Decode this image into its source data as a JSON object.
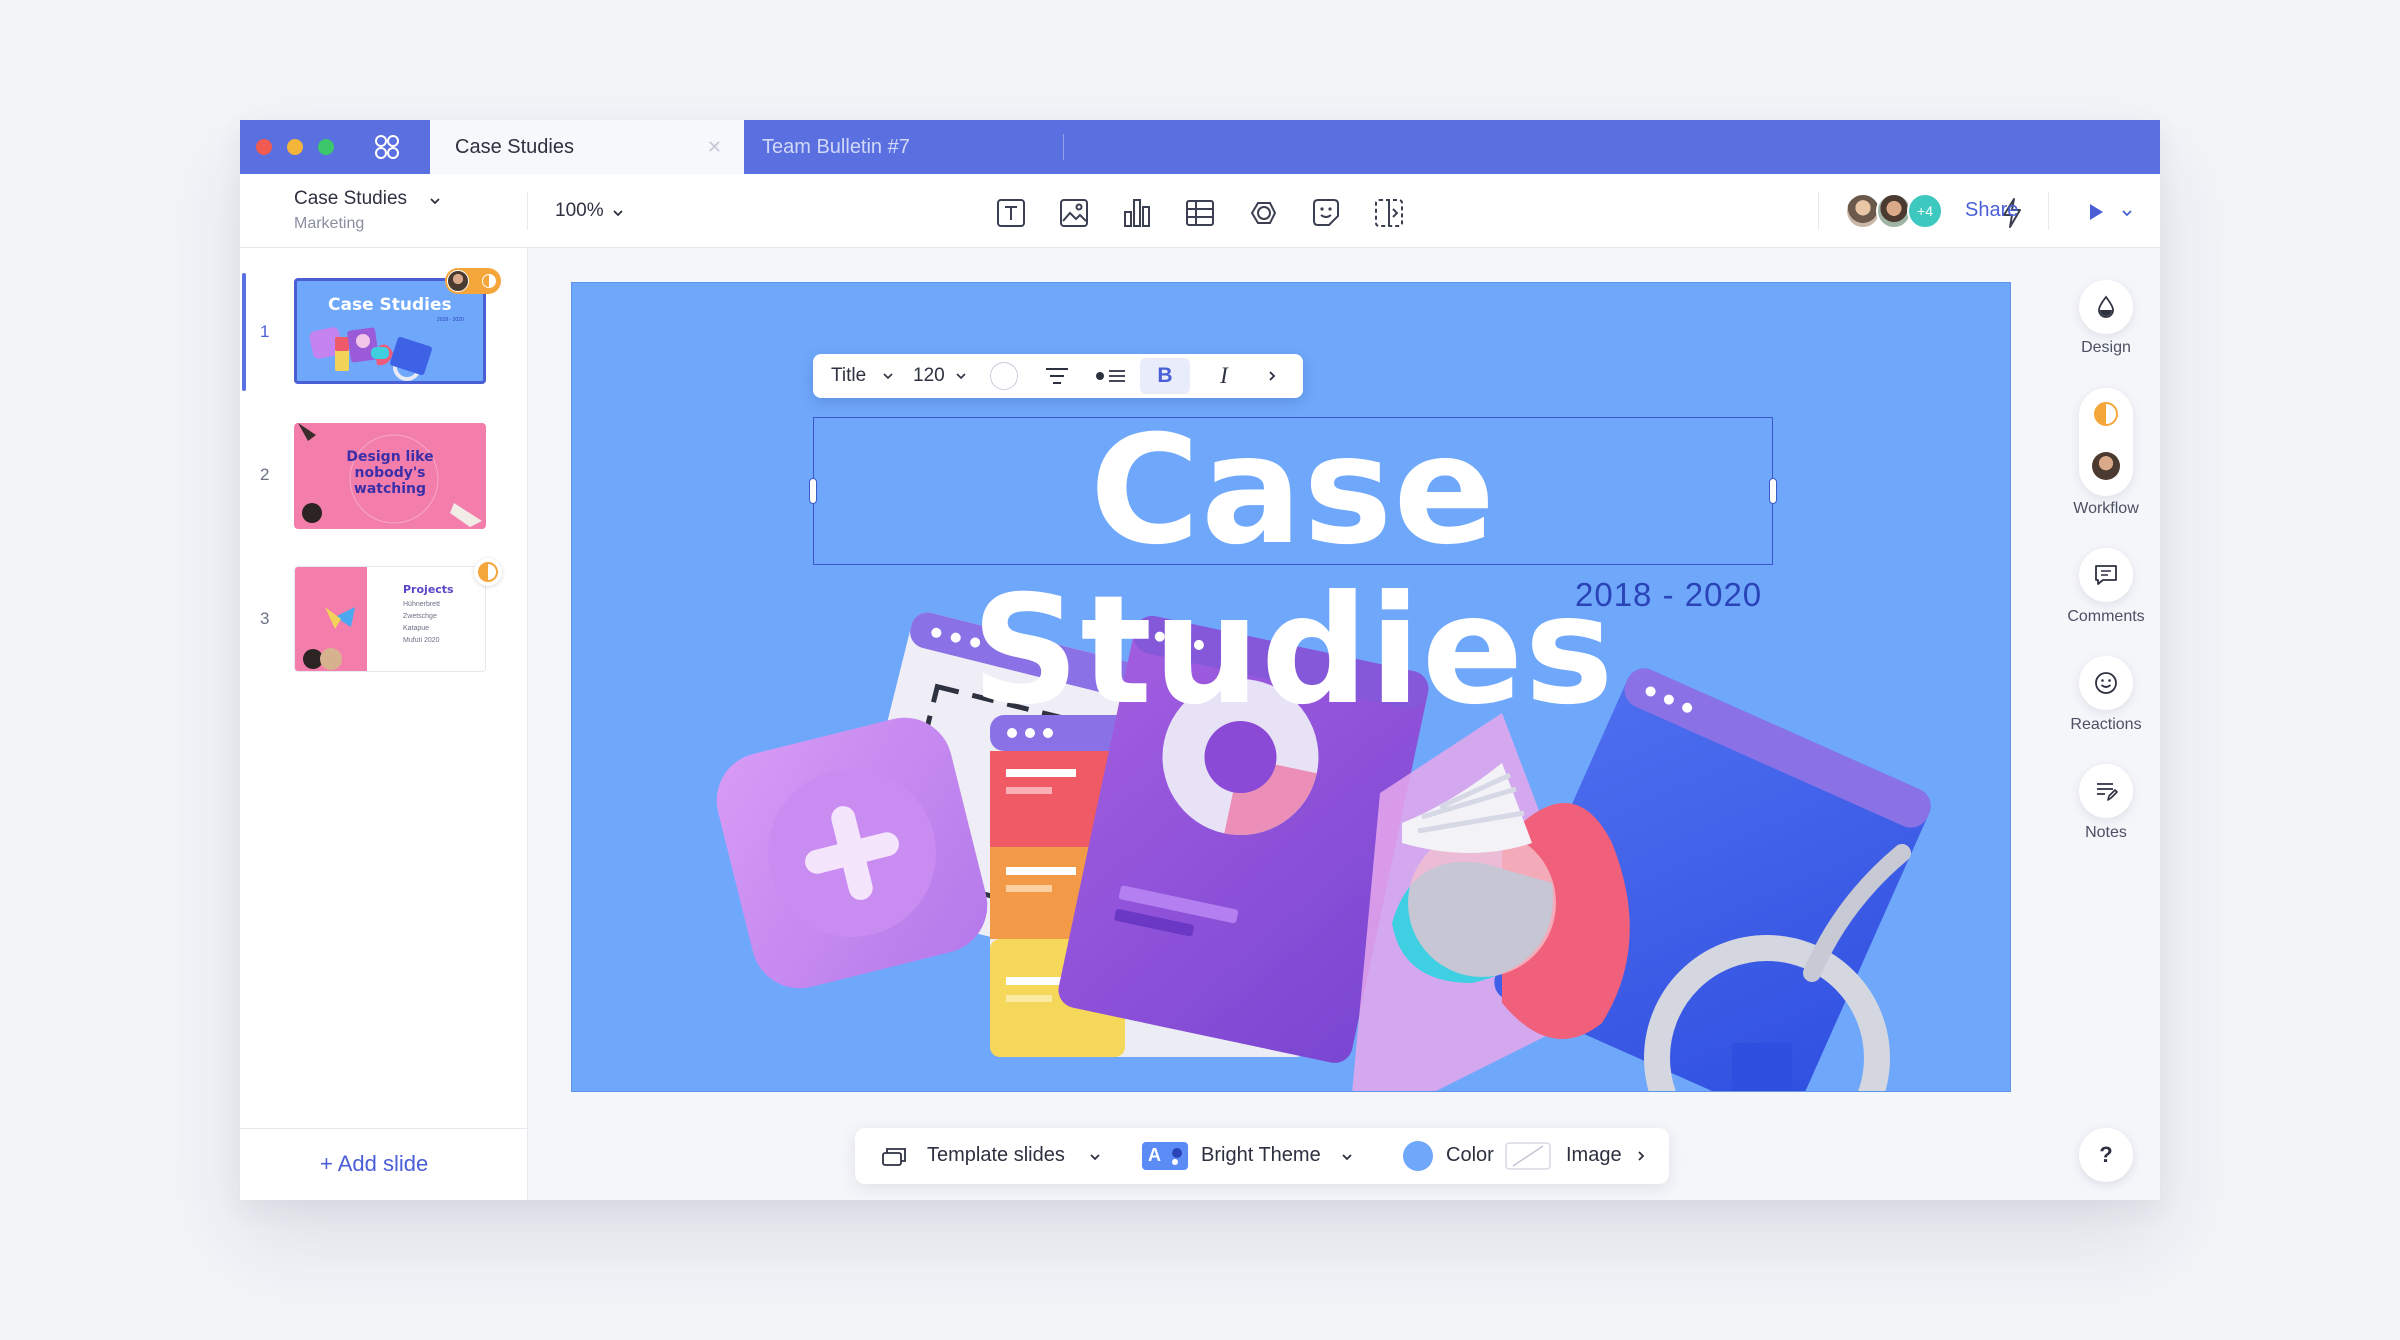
{
  "window": {
    "tabs": [
      {
        "label": "Case Studies",
        "active": true
      },
      {
        "label": "Team Bulletin #7",
        "active": false
      }
    ]
  },
  "toolbar": {
    "doc_title": "Case Studies",
    "doc_subtitle": "Marketing",
    "zoom": "100%",
    "insert_tools": [
      "text-icon",
      "image-icon",
      "chart-icon",
      "table-icon",
      "shape-icon",
      "sticker-icon",
      "embed-icon"
    ],
    "collaborators_extra": "+4",
    "share_label": "Share"
  },
  "sidebar": {
    "slides": [
      {
        "number": "1",
        "title": "Case Studies",
        "subtitle": "2018 - 2020"
      },
      {
        "number": "2",
        "title": "Design like nobody's watching"
      },
      {
        "number": "3",
        "title": "Projects",
        "items": [
          "Hühnerbrett",
          "Zwetschge",
          "Katapue",
          "Mufuti 2020"
        ]
      }
    ],
    "add_slide_label": "+ Add slide"
  },
  "canvas": {
    "format_bar": {
      "style": "Title",
      "size": "120",
      "bold": "B",
      "italic": "I"
    },
    "title": "Case Studies",
    "subtitle": "2018 - 2020"
  },
  "right_rail": [
    {
      "label": "Design",
      "icon": "droplet-icon"
    },
    {
      "label": "Workflow",
      "icon": "workflow-icon"
    },
    {
      "label": "Comments",
      "icon": "comment-icon"
    },
    {
      "label": "Reactions",
      "icon": "smiley-icon"
    },
    {
      "label": "Notes",
      "icon": "notes-icon"
    }
  ],
  "bottom_bar": {
    "template_label": "Template slides",
    "theme_label": "Bright Theme",
    "color_label": "Color",
    "image_label": "Image"
  },
  "help_label": "?",
  "colors": {
    "accent": "#5a6fe0",
    "canvas_bg": "#6fa8fb",
    "title_text": "#ffffff",
    "subtitle_text": "#2a44b8"
  }
}
